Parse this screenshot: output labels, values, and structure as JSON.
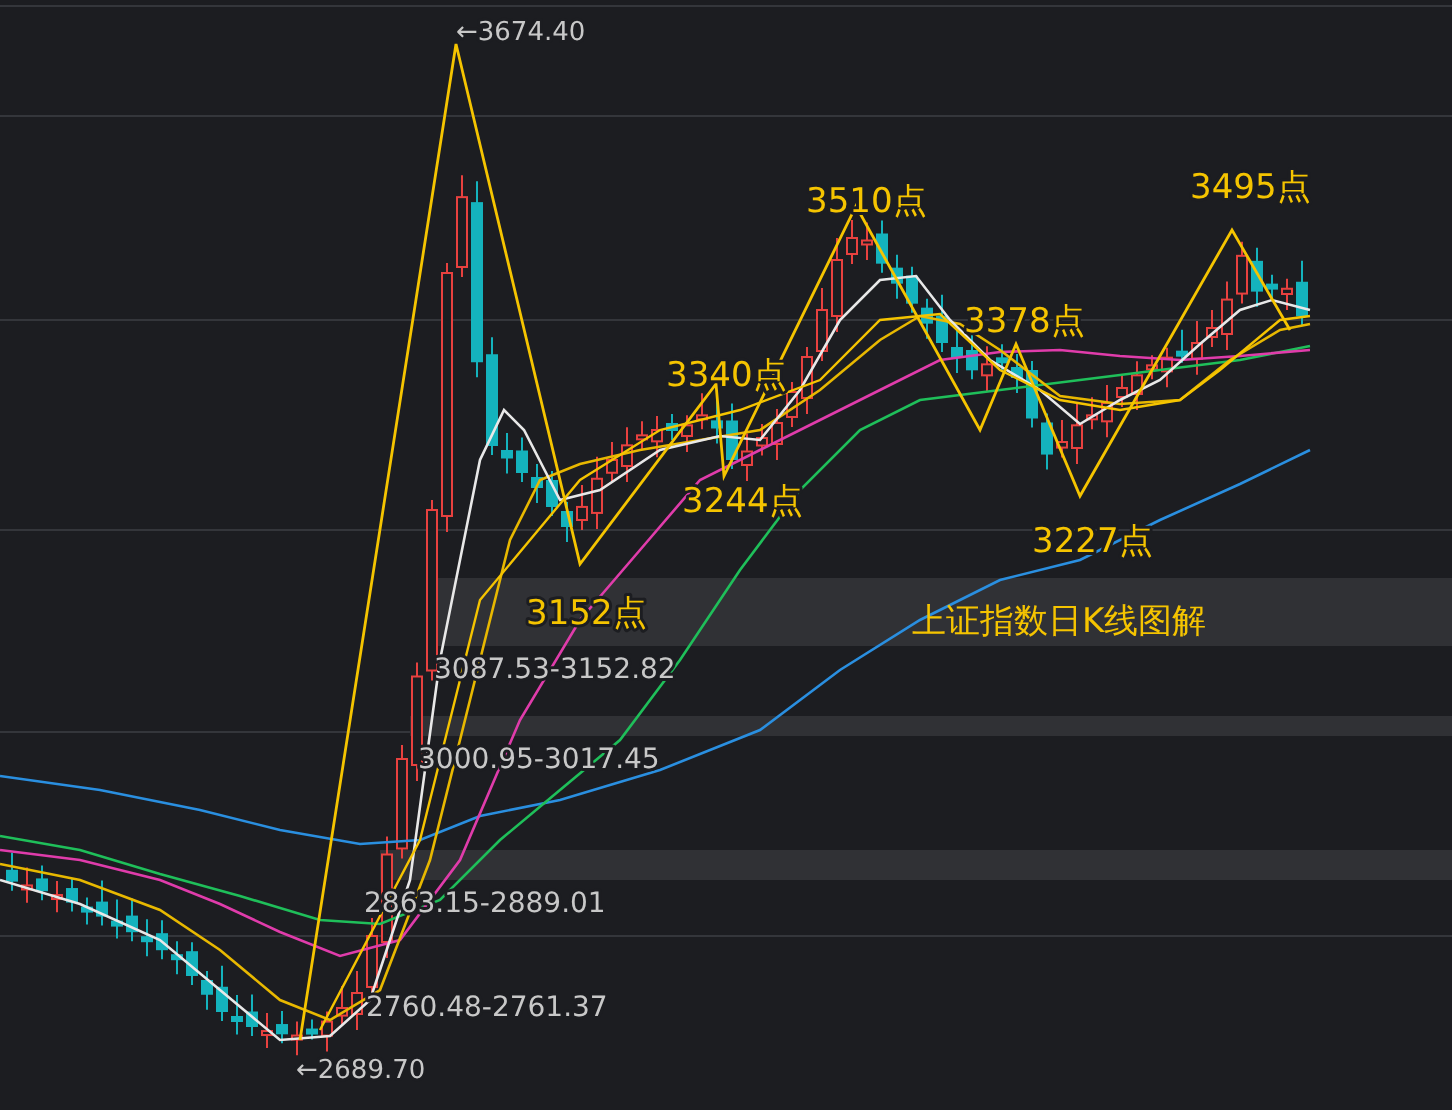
{
  "chart": {
    "title": "上证指数日K线图解",
    "labels": [
      {
        "kind": "extreme",
        "text": "←3674.40"
      },
      {
        "kind": "point",
        "text": "3510点"
      },
      {
        "kind": "point",
        "text": "3495点"
      },
      {
        "kind": "point",
        "text": "3340点"
      },
      {
        "kind": "point",
        "text": "3378点"
      },
      {
        "kind": "point",
        "text": "3244点"
      },
      {
        "kind": "point",
        "text": "3227点"
      },
      {
        "kind": "point",
        "text": "3152点"
      },
      {
        "kind": "range",
        "text": "3087.53-3152.82"
      },
      {
        "kind": "range",
        "text": "3000.95-3017.45"
      },
      {
        "kind": "range",
        "text": "2863.15-2889.01"
      },
      {
        "kind": "range",
        "text": "2760.48-2761.37"
      },
      {
        "kind": "extreme",
        "text": "←2689.70"
      }
    ]
  }
}
